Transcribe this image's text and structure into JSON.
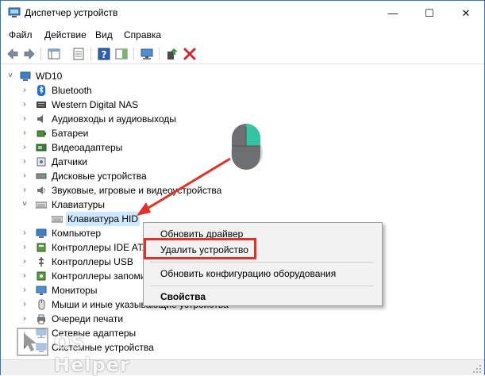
{
  "window": {
    "title": "Диспетчер устройств",
    "minimize": "—",
    "maximize": "☐",
    "close": "✕",
    "border_color": "#2b79c9"
  },
  "menubar": {
    "items": [
      "Файл",
      "Действие",
      "Вид",
      "Справка"
    ]
  },
  "toolbar": {
    "icons": [
      "back-icon",
      "forward-icon",
      "show-hide-tree-icon",
      "properties-icon",
      "help-icon",
      "action-pane-icon",
      "monitor-icon",
      "update-driver-icon",
      "uninstall-icon"
    ]
  },
  "tree": {
    "root": {
      "label": "WD10",
      "expanded": true
    },
    "items": [
      {
        "label": "Bluetooth",
        "icon": "bluetooth-icon",
        "expanded": false
      },
      {
        "label": "Western Digital NAS",
        "icon": "nas-icon",
        "expanded": false
      },
      {
        "label": "Аудиовходы и аудиовыходы",
        "icon": "speaker-icon",
        "expanded": false
      },
      {
        "label": "Батареи",
        "icon": "battery-icon",
        "expanded": false
      },
      {
        "label": "Видеоадаптеры",
        "icon": "display-adapter-icon",
        "expanded": false
      },
      {
        "label": "Датчики",
        "icon": "sensor-icon",
        "expanded": false
      },
      {
        "label": "Дисковые устройства",
        "icon": "disk-icon",
        "expanded": false
      },
      {
        "label": "Звуковые, игровые и видеоустройства",
        "icon": "sound-icon",
        "expanded": false
      },
      {
        "label": "Клавиатуры",
        "icon": "keyboard-icon",
        "expanded": true
      },
      {
        "label": "Клавиатура HID",
        "icon": "keyboard-icon",
        "child": true,
        "selected": true
      },
      {
        "label": "Компьютер",
        "icon": "computer-icon",
        "expanded": false
      },
      {
        "label": "Контроллеры IDE ATA/ATAPI",
        "icon": "ide-icon",
        "expanded": false
      },
      {
        "label": "Контроллеры USB",
        "icon": "usb-icon",
        "expanded": false
      },
      {
        "label": "Контроллеры запоминающих устройств",
        "icon": "storage-icon",
        "expanded": false
      },
      {
        "label": "Мониторы",
        "icon": "monitor-icon",
        "expanded": false
      },
      {
        "label": "Мыши и иные указывающие устройства",
        "icon": "mouse-icon",
        "expanded": false
      },
      {
        "label": "Очереди печати",
        "icon": "printer-icon",
        "expanded": false
      },
      {
        "label": "Сетевые адаптеры",
        "icon": "network-icon",
        "expanded": false
      },
      {
        "label": "Системные устройства",
        "icon": "system-icon",
        "expanded": false
      }
    ]
  },
  "context_menu": {
    "items": [
      "Обновить драйвер",
      "Удалить устройство",
      "Обновить конфигурацию оборудования",
      "Свойства"
    ],
    "highlighted": "Удалить устройство",
    "highlight_color": "#e5302a"
  },
  "watermark": {
    "text": "OS Helper"
  }
}
